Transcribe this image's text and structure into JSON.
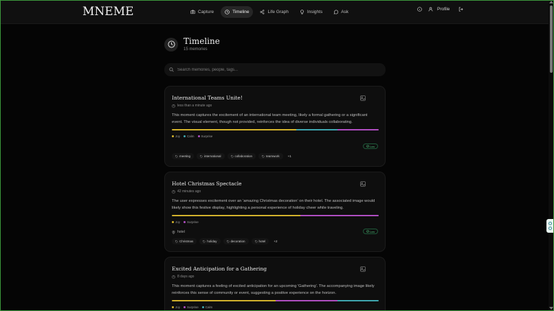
{
  "app": {
    "logo": "MNEME"
  },
  "nav": {
    "items": [
      {
        "label": "Capture",
        "icon": "camera-icon"
      },
      {
        "label": "Timeline",
        "icon": "clock-icon",
        "active": true
      },
      {
        "label": "Life Graph",
        "icon": "share-graph-icon"
      },
      {
        "label": "Insights",
        "icon": "lightbulb-icon"
      },
      {
        "label": "Ask",
        "icon": "chat-bubble-icon"
      }
    ],
    "info_icon": "info-icon",
    "profile_label": "Profile",
    "profile_icon": "user-icon",
    "logout_icon": "logout-icon"
  },
  "page": {
    "title": "Timeline",
    "subtitle": "15 memories",
    "icon": "clock-icon"
  },
  "search": {
    "placeholder": "Search memories, people, tags..."
  },
  "colors": {
    "Joy": "#d4b32c",
    "Calm": "#3fa7b0",
    "Surprise": "#b04ec2",
    "accent_green": "#4fbf7a"
  },
  "cards": [
    {
      "title": "International Teams Unite!",
      "time": "less than a minute ago",
      "description": "This moment captures the excitement of an international team meeting, likely a formal gathering or a significant event. The visual element, though not provided, reinforces the idea of diverse individuals collaborating.",
      "emotions": [
        {
          "name": "Joy",
          "share": 0.6
        },
        {
          "name": "Calm",
          "share": 0.2
        },
        {
          "name": "Surprise",
          "share": 0.2
        }
      ],
      "badge": "Low",
      "tags": [
        "meeting",
        "international",
        "collaboration",
        "teamwork"
      ],
      "more": "+1"
    },
    {
      "title": "Hotel Christmas Spectacle",
      "time": "42 minutes ago",
      "description": "The user expresses excitement over an 'amazing Christmas decoration' on their hotel. The associated image would likely show this festive display, highlighting a personal experience of holiday cheer while traveling.",
      "emotions": [
        {
          "name": "Joy",
          "share": 0.62
        },
        {
          "name": "Surprise",
          "share": 0.38
        }
      ],
      "location": "hotel",
      "badge": "Low",
      "tags": [
        "Christmas",
        "holiday",
        "decoration",
        "hotel"
      ],
      "more": "+2"
    },
    {
      "title": "Excited Anticipation for a Gathering",
      "time": "8 days ago",
      "description": "This moment captures a feeling of excited anticipation for an upcoming 'Gathering'. The accompanying image likely reinforces this sense of community or event, suggesting a positive experience on the horizon.",
      "emotions": [
        {
          "name": "Joy",
          "share": 0.5
        },
        {
          "name": "Surprise",
          "share": 0.3
        },
        {
          "name": "Calm",
          "share": 0.2
        }
      ]
    }
  ]
}
